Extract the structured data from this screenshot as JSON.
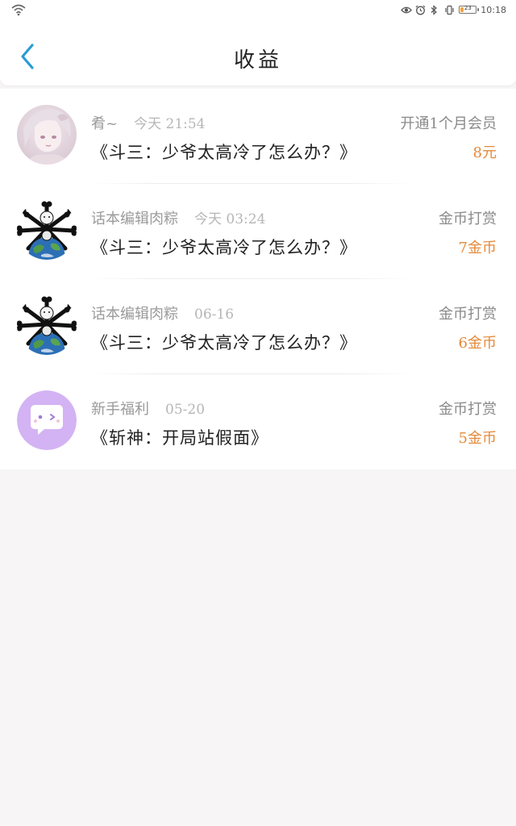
{
  "status_bar": {
    "time": "10:18",
    "battery_level": "23"
  },
  "header": {
    "title": "收益"
  },
  "colors": {
    "accent": "#2a9bd8",
    "amount": "#e48a3a",
    "avatar_purple": "#d3b3f3"
  },
  "income_list": [
    {
      "user": "肴~",
      "time": "今天 21:54",
      "book": "《斗三：少爷太高冷了怎么办？》",
      "type": "开通1个月会员",
      "amount": "8元",
      "avatar": "anime-girl-avatar"
    },
    {
      "user": "话本编辑肉粽",
      "time": "今天 03:24",
      "book": "《斗三：少爷太高冷了怎么办？》",
      "type": "金币打赏",
      "amount": "7金币",
      "avatar": "bone-earth-avatar"
    },
    {
      "user": "话本编辑肉粽",
      "time": "06-16",
      "book": "《斗三：少爷太高冷了怎么办？》",
      "type": "金币打赏",
      "amount": "6金币",
      "avatar": "bone-earth-avatar"
    },
    {
      "user": "新手福利",
      "time": "05-20",
      "book": "《斩神：开局站假面》",
      "type": "金币打赏",
      "amount": "5金币",
      "avatar": "chat-bubble-avatar"
    }
  ]
}
